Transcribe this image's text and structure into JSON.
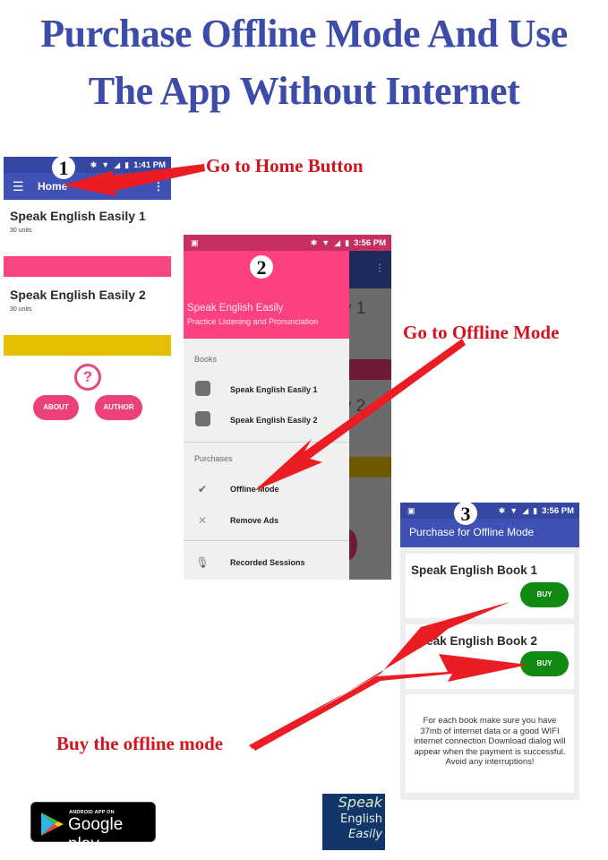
{
  "headline": {
    "line1": "Purchase Offline Mode And Use",
    "line2": "The App Without Internet"
  },
  "callouts": {
    "home": "Go to Home Button",
    "offline": "Go to Offline Mode",
    "buy": "Buy the offline  mode"
  },
  "steps": [
    "1",
    "2",
    "3"
  ],
  "screen1": {
    "status_time": "1:41 PM",
    "toolbar_title": "Home",
    "books": [
      {
        "title": "Speak English Easily 1",
        "subtitle": "30 units",
        "color": "#fb4582"
      },
      {
        "title": "Speak English Easily 2",
        "subtitle": "30 units",
        "color": "#e5c000"
      }
    ],
    "help_glyph": "?",
    "buttons": {
      "about": "ABOUT",
      "author": "AUTHOR"
    }
  },
  "screen2": {
    "status_time": "3:56 PM",
    "header_title": "Speak English Easily",
    "header_subtitle": "Practice Listening and Pronunciation",
    "sections": {
      "books": "Books",
      "purchases": "Purchases"
    },
    "book_items": [
      "Speak English Easily 1",
      "Speak English Easily 2"
    ],
    "purchase_items": [
      {
        "label": "Offline Mode",
        "icon": "check-circle-icon"
      },
      {
        "label": "Remove Ads",
        "icon": "close-icon"
      }
    ],
    "extra_item": {
      "label": "Recorded Sessions",
      "icon": "microphone-icon"
    },
    "background_peek": {
      "text1": "y 1",
      "text2": "y 2"
    }
  },
  "screen3": {
    "status_time": "3:56 PM",
    "title": "Purchase for Offline Mode",
    "products": [
      {
        "title": "Speak English Book 1",
        "button": "BUY"
      },
      {
        "title": "Speak English Book 2",
        "button": "BUY"
      }
    ],
    "note": "For each book make sure you have 37mb of internet data or a good WIFI internet connection Download dialog will appear when the payment is successful. Avoid any interruptions!"
  },
  "footer": {
    "google_play_small": "ANDROID APP ON",
    "google_play_big": "Google play",
    "logo_lines": [
      "Speak",
      "English",
      "Easily"
    ]
  },
  "colors": {
    "headline": "#3c4ca8",
    "callout": "#d2141e",
    "app_bar": "#3f51b5",
    "accent_pink": "#fd4081",
    "buy_green": "#128a12"
  }
}
